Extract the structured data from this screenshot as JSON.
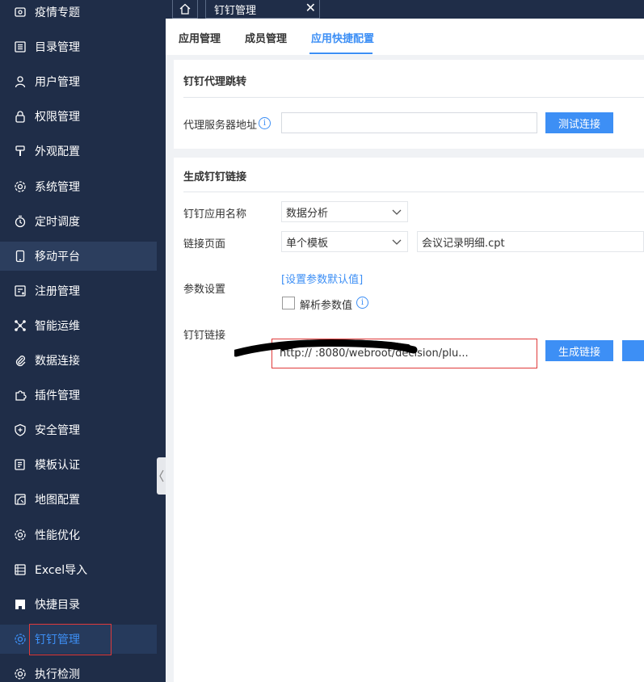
{
  "sidebar": {
    "items": [
      {
        "label": "疫情专题",
        "icon": "epidemic-icon"
      },
      {
        "label": "目录管理",
        "icon": "list-icon"
      },
      {
        "label": "用户管理",
        "icon": "user-icon"
      },
      {
        "label": "权限管理",
        "icon": "lock-icon"
      },
      {
        "label": "外观配置",
        "icon": "brush-icon"
      },
      {
        "label": "系统管理",
        "icon": "gear-icon"
      },
      {
        "label": "定时调度",
        "icon": "timer-icon"
      },
      {
        "label": "移动平台",
        "icon": "mobile-icon"
      },
      {
        "label": "注册管理",
        "icon": "register-icon"
      },
      {
        "label": "智能运维",
        "icon": "network-icon"
      },
      {
        "label": "数据连接",
        "icon": "paperclip-icon"
      },
      {
        "label": "插件管理",
        "icon": "puzzle-icon"
      },
      {
        "label": "安全管理",
        "icon": "shield-icon"
      },
      {
        "label": "模板认证",
        "icon": "template-icon"
      },
      {
        "label": "地图配置",
        "icon": "map-icon"
      },
      {
        "label": "性能优化",
        "icon": "gear-icon"
      },
      {
        "label": "Excel导入",
        "icon": "excel-icon"
      },
      {
        "label": "快捷目录",
        "icon": "shortcut-icon"
      },
      {
        "label": "钉钉管理",
        "icon": "gear-icon"
      },
      {
        "label": "执行检测",
        "icon": "gear-icon"
      }
    ]
  },
  "topbar": {
    "tab_label": "钉钉管理",
    "close_glyph": "✕"
  },
  "subtabs": [
    "应用管理",
    "成员管理",
    "应用快捷配置"
  ],
  "proxy_panel": {
    "title": "钉钉代理跳转",
    "server_label": "代理服务器地址",
    "server_value": "",
    "test_button": "测试连接"
  },
  "link_panel": {
    "title": "生成钉钉链接",
    "app_name_label": "钉钉应用名称",
    "app_name_value": "数据分析",
    "page_label": "链接页面",
    "page_type_value": "单个模板",
    "template_value": "会议记录明细.cpt",
    "param_label": "参数设置",
    "param_link": "[设置参数默认值]",
    "parse_label": "解析参数值",
    "link_label": "钉钉链接",
    "link_value": "http://                        :8080/webroot/decision/plu...",
    "generate_button": "生成链接"
  },
  "colors": {
    "sidebar_bg": "#1f2d48",
    "accent": "#3d8ff5",
    "highlight_red": "#e03a3a"
  }
}
